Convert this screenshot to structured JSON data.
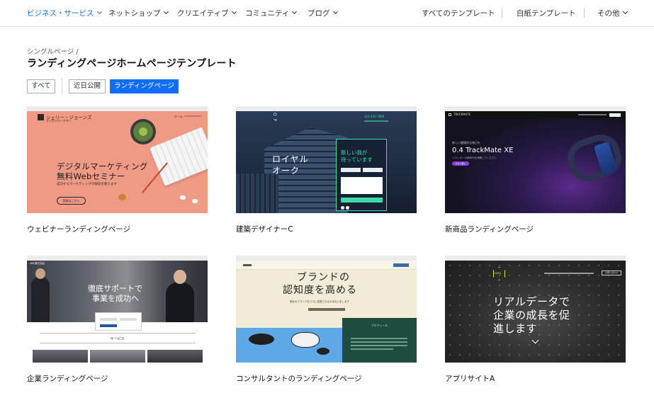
{
  "nav": {
    "left": [
      {
        "label": "ビジネス・サービス",
        "active": true
      },
      {
        "label": "ネットショップ"
      },
      {
        "label": "クリエイティブ"
      },
      {
        "label": "コミュニティ"
      },
      {
        "label": "ブログ"
      }
    ],
    "right": [
      "すべてのテンプレート",
      "白紙テンプレート",
      "その他"
    ]
  },
  "breadcrumb": "シングルページ /",
  "page_title": "ランディングページホームページテンプレート",
  "filters": [
    "すべて",
    "近日公開",
    "ランディングページ"
  ],
  "active_filter": "ランディングページ",
  "cards": [
    {
      "label": "ウェビナーランディングページ",
      "thumb": {
        "brand_name": "シェリー・ジョーンズ",
        "brand_sub": "デジタルマーケター",
        "nav": "ホーム",
        "headline_1": "デジタルマーケティング",
        "headline_2": "無料Webセミナー",
        "sub": "成功するマーケティングの秘訣を教えます",
        "button": "登録はこちら"
      }
    },
    {
      "label": "建築デザイナーC",
      "thumb": {
        "logo": "O P",
        "phone": "123-456-7890",
        "headline_1": "ロイヤル",
        "headline_2": "オーク",
        "form_title_1": "新しい我が",
        "form_title_2": "待っています"
      }
    },
    {
      "label": "新商品ランディングページ",
      "thumb": {
        "brand": "TRACKMATE",
        "pre": "新しい健康的な毎日を",
        "headline": "0.4 TrackMate XE",
        "sub": "トラッカーの新時代を体験してください",
        "button": "今すぐ購入"
      }
    },
    {
      "label": "企業ランディングページ",
      "thumb": {
        "logo": "ABC株式会社",
        "headline_1": "徹底サポートで",
        "headline_2": "事業を成功へ",
        "section": "サービス"
      }
    },
    {
      "label": "コンサルタントのランディングページ",
      "thumb": {
        "headline_1": "ブランドの",
        "headline_2": "認知度を高める",
        "sub": "御社のブランドをさらに成長させるお手伝いをします",
        "dark_title": "プロフィール"
      }
    },
    {
      "label": "アプリサイトA",
      "thumb": {
        "logo": "DATA",
        "headline_1": "リアルデータで",
        "headline_2": "企業の成長を促",
        "headline_3": "進します",
        "button": "お問い合わせ"
      }
    }
  ],
  "colors": {
    "accent": "#116dff",
    "salmon": "#ef9a85",
    "navy": "#1a2b44",
    "purple_dark": "#141221",
    "corporate_blue": "#21579a",
    "consult_bg": "#f0ecd8",
    "consult_green": "#1c4d3f",
    "app_bg": "#2b2b2b"
  }
}
